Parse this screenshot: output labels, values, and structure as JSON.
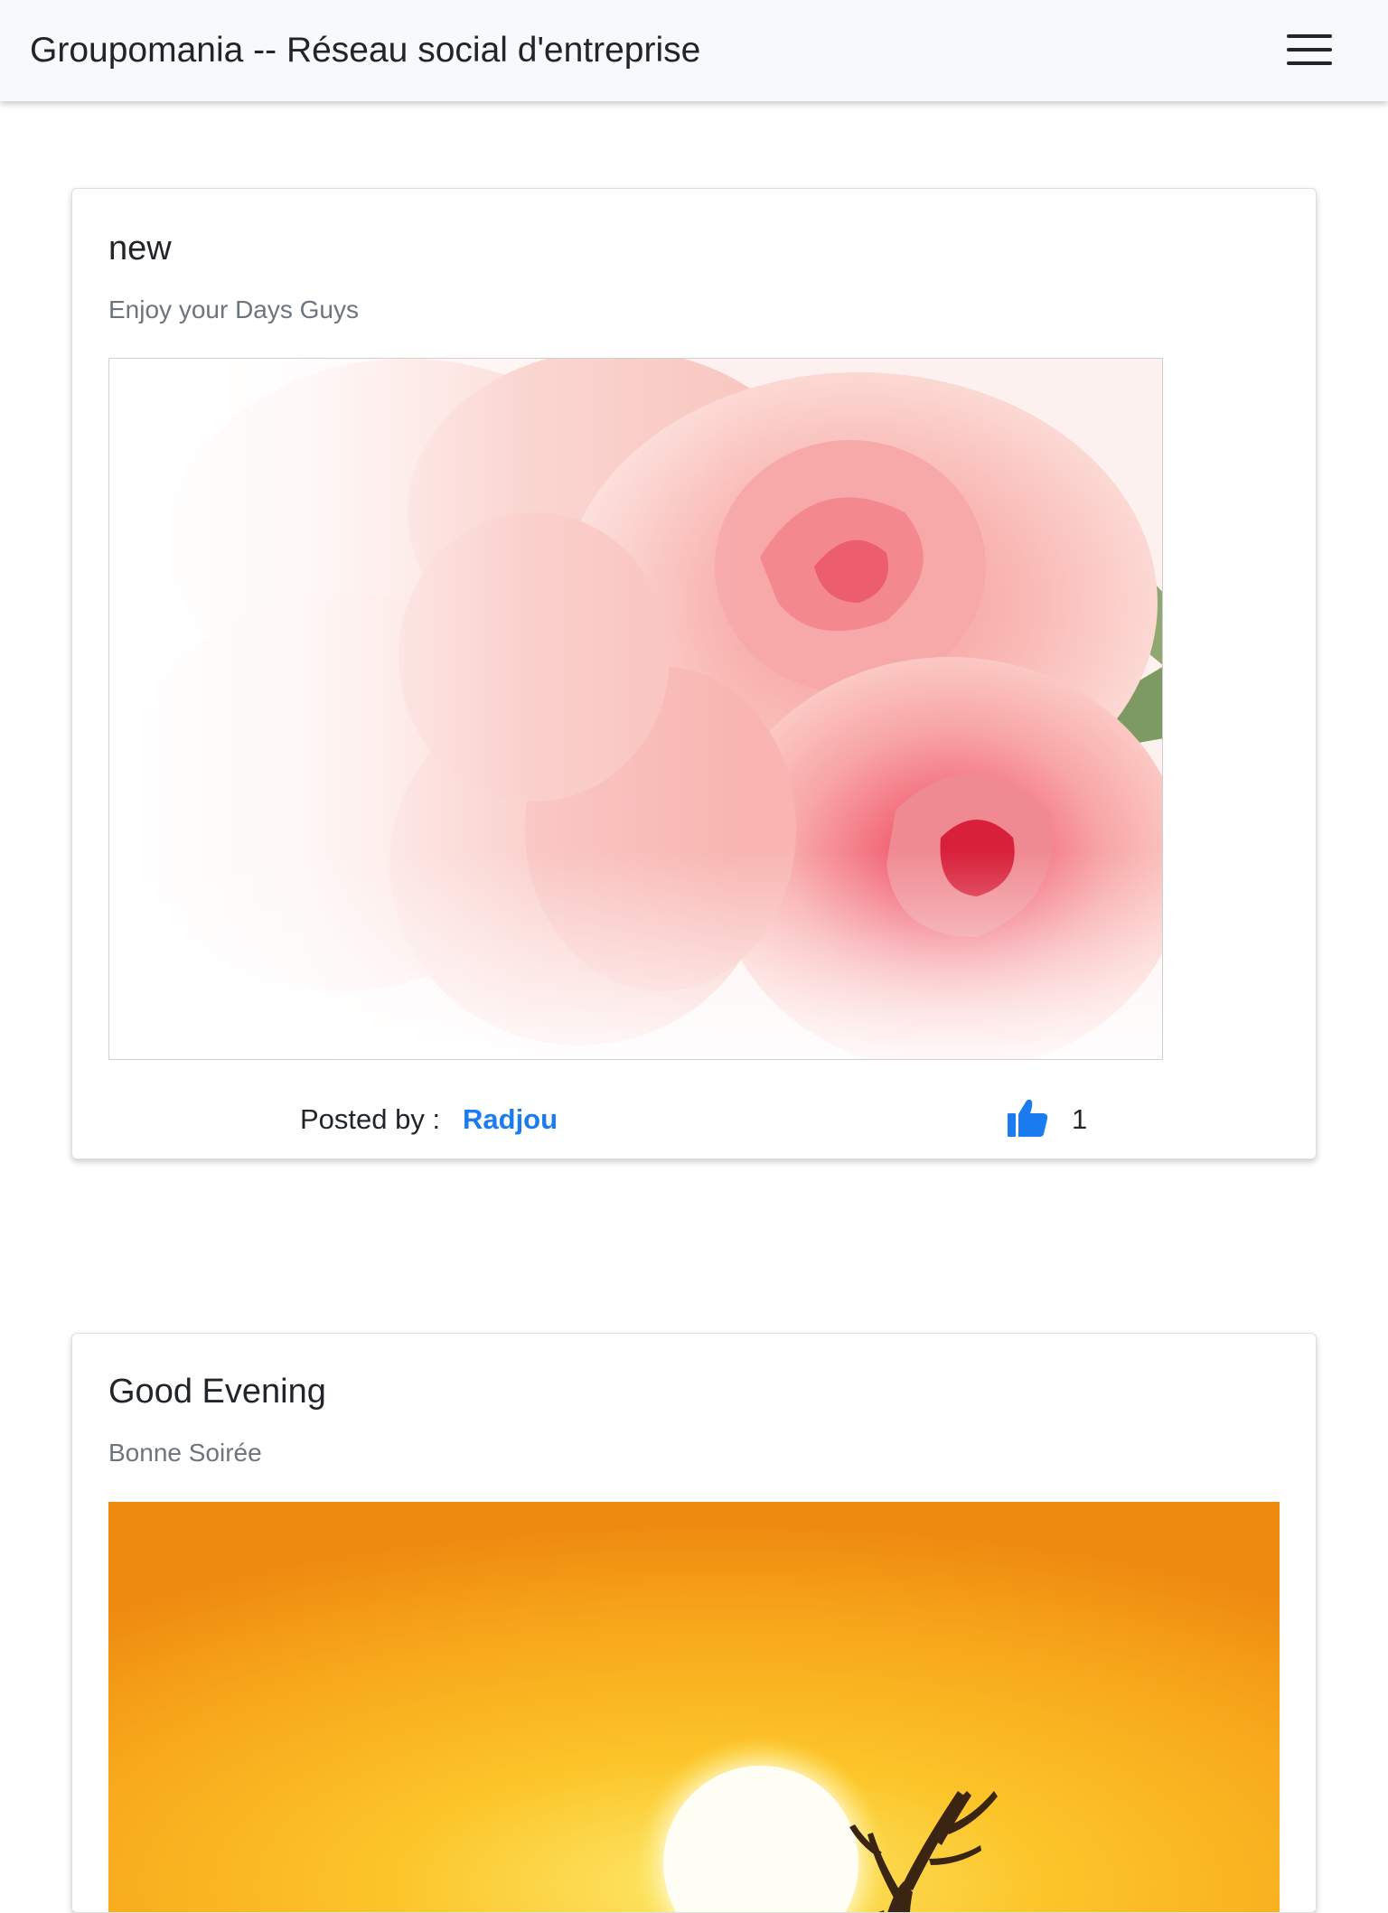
{
  "navbar": {
    "brand": "Groupomania -- Réseau social d'entreprise",
    "menu_icon": "hamburger-menu-icon"
  },
  "posts": [
    {
      "title": "new",
      "text": "Enjoy your Days Guys",
      "image": "pink-roses-photo",
      "posted_by_label": "Posted by :",
      "author": "Radjou",
      "like_icon": "thumbs-up-icon",
      "likes": "1"
    },
    {
      "title": "Good Evening",
      "text": "Bonne Soirée",
      "image": "sunset-deer-photo"
    }
  ],
  "colors": {
    "navbar_bg": "#f8f9fa",
    "link_blue": "#1a7cf0",
    "muted_text": "#6c757d",
    "like_blue": "#1a7cf0"
  }
}
